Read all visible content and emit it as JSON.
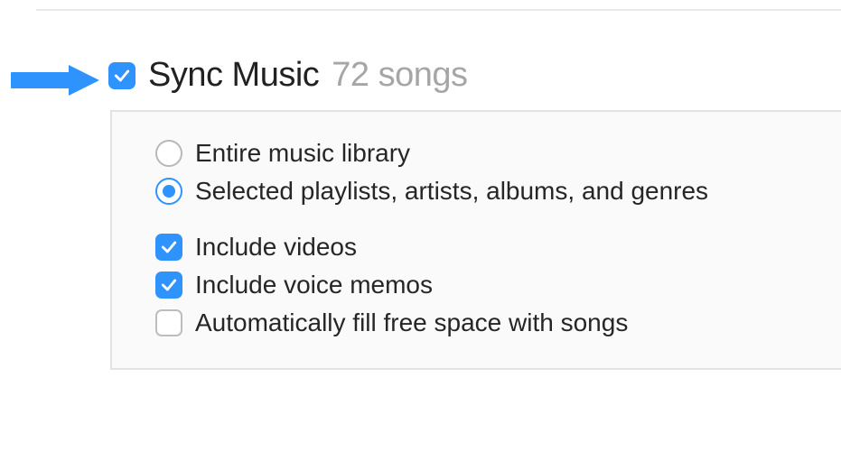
{
  "header": {
    "checkbox_checked": true,
    "title": "Sync Music",
    "subtitle": "72 songs"
  },
  "radio_group": {
    "selected": 1,
    "options": [
      {
        "label": "Entire music library"
      },
      {
        "label": "Selected playlists, artists, albums, and genres"
      }
    ]
  },
  "checkboxes": [
    {
      "label": "Include videos",
      "checked": true
    },
    {
      "label": "Include voice memos",
      "checked": true
    },
    {
      "label": "Automatically fill free space with songs",
      "checked": false
    }
  ]
}
